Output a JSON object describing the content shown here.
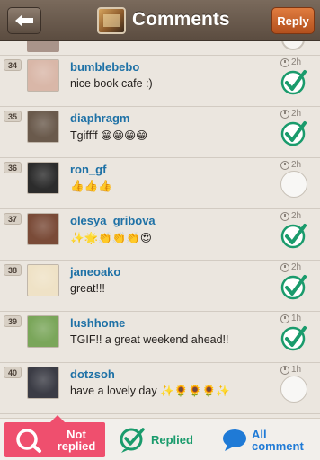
{
  "header": {
    "title": "Comments",
    "reply_label": "Reply"
  },
  "comments": [
    {
      "num": "34",
      "username": "bumblebebo",
      "text": "nice book cafe :)",
      "time": "2h",
      "replied": true,
      "avatar_color": "#d9b7a8"
    },
    {
      "num": "35",
      "username": "diaphragm",
      "text": "Tgiffff 😁😁😁😁",
      "time": "2h",
      "replied": true,
      "avatar_color": "#6a5a4c"
    },
    {
      "num": "36",
      "username": "ron_gf",
      "text": "👍👍👍",
      "time": "2h",
      "replied": false,
      "avatar_color": "#2c2c2c"
    },
    {
      "num": "37",
      "username": "olesya_gribova",
      "text": "✨🌟👏👏👏😍",
      "time": "2h",
      "replied": true,
      "avatar_color": "#7a4b38"
    },
    {
      "num": "38",
      "username": "janeoako",
      "text": "great!!!",
      "time": "2h",
      "replied": true,
      "avatar_color": "#efe2c6"
    },
    {
      "num": "39",
      "username": "lushhome",
      "text": "TGIF!! a great weekend ahead!!",
      "time": "1h",
      "replied": true,
      "avatar_color": "#7aa65a"
    },
    {
      "num": "40",
      "username": "dotzsoh",
      "text": "have a lovely day ✨🌻🌻🌻✨",
      "time": "1h",
      "replied": false,
      "avatar_color": "#3b3c45"
    }
  ],
  "tabs": {
    "not_replied": "Not replied",
    "replied": "Replied",
    "all_comment": "All comment"
  },
  "colors": {
    "accent_pink": "#ef4f6e",
    "replied_green": "#1a9b6c",
    "all_blue": "#1f7ad6",
    "username_blue": "#1e71a6"
  },
  "icons": {
    "back": "back-arrow-icon",
    "check": "check-circle-icon",
    "clock": "clock-icon",
    "not_replied": "magnifier-bubble-icon",
    "replied": "check-bubble-icon",
    "all_comment": "speech-bubble-icon"
  }
}
